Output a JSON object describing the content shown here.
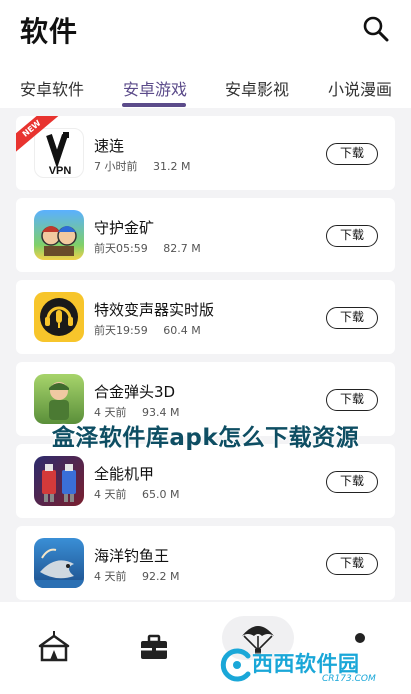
{
  "header": {
    "title": "软件"
  },
  "tabs": [
    {
      "label": "安卓软件"
    },
    {
      "label": "安卓游戏"
    },
    {
      "label": "安卓影视"
    },
    {
      "label": "小说漫画"
    }
  ],
  "active_tab": "安卓游戏",
  "apps": [
    {
      "name": "速连",
      "time": "7 小时前",
      "size": "31.2 M",
      "badge": "NEW",
      "icon": "vpn-icon",
      "icon_text": "VPN",
      "button": "下载"
    },
    {
      "name": "守护金矿",
      "time": "前天05:59",
      "size": "82.7 M",
      "icon": "game-knights-icon",
      "button": "下载"
    },
    {
      "name": "特效变声器实时版",
      "time": "前天19:59",
      "size": "60.4 M",
      "icon": "headphone-mic-icon",
      "button": "下载"
    },
    {
      "name": "合金弹头3D",
      "time": "4 天前",
      "size": "93.4 M",
      "icon": "soldier-icon",
      "button": "下载"
    },
    {
      "name": "全能机甲",
      "time": "4 天前",
      "size": "65.0 M",
      "icon": "mech-robot-icon",
      "button": "下载"
    },
    {
      "name": "海洋钓鱼王",
      "time": "4 天前",
      "size": "92.2 M",
      "icon": "fishing-icon",
      "button": "下载"
    }
  ],
  "overlay_caption": "盒泽软件库apk怎么下载资源",
  "watermark": {
    "text": "西西软件园",
    "url": "CR173.COM"
  },
  "colors": {
    "accent": "#5b4b8a",
    "caption": "#0e4e63",
    "watermark": "#1aa7d8",
    "badge": "#e8332f"
  }
}
